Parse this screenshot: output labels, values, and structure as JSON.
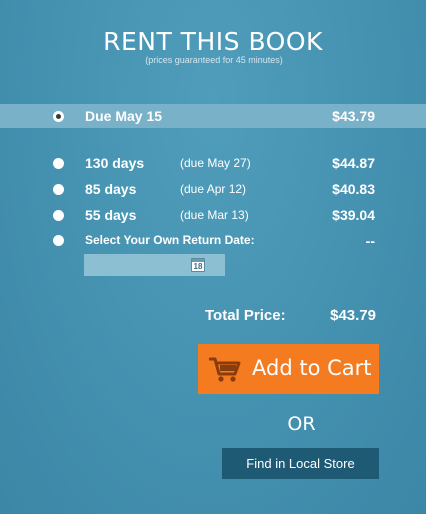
{
  "header": {
    "title": "RENT THIS BOOK",
    "subtitle": "(prices guaranteed for 45 minutes)"
  },
  "options": [
    {
      "label": "Due May 15",
      "due": "",
      "price": "$43.79",
      "selected": true
    },
    {
      "label": "130 days",
      "due": "(due May 27)",
      "price": "$44.87",
      "selected": false
    },
    {
      "label": "85 days",
      "due": "(due Apr 12)",
      "price": "$40.83",
      "selected": false
    },
    {
      "label": "55 days",
      "due": "(due Mar 13)",
      "price": "$39.04",
      "selected": false
    },
    {
      "label": "Select Your Own Return Date:",
      "due": "",
      "price": "--",
      "selected": false
    }
  ],
  "date_picker": {
    "value": "",
    "icon": "calendar-icon",
    "icon_text": "18"
  },
  "total": {
    "label": "Total Price:",
    "value": "$43.79"
  },
  "add_to_cart": {
    "label": "Add to Cart",
    "icon": "cart-icon",
    "color": "#f47b20"
  },
  "separator": "OR",
  "find_store": {
    "label": "Find in Local Store",
    "color": "#1f5a74"
  }
}
